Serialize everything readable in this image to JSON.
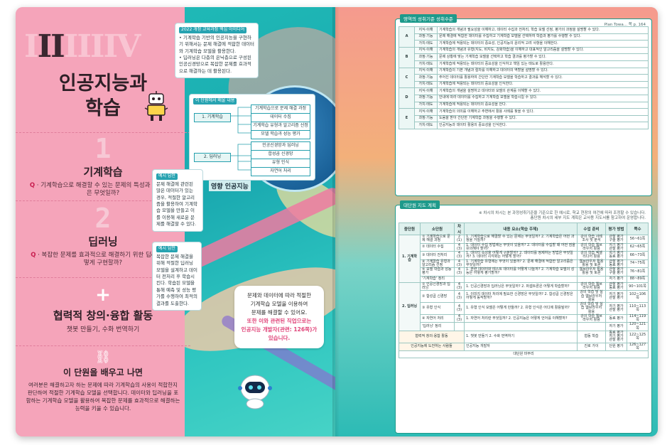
{
  "left": {
    "romans": [
      "I",
      "II",
      "III",
      "IV"
    ],
    "title_line1": "인공지능과",
    "title_line2": "학습",
    "sections": [
      {
        "num": "1",
        "title": "기계학습",
        "q_mark": "Q",
        "question": "기계학습으로 해결할 수 있는 문제의 특성과 해결 방법은 무엇일까?"
      },
      {
        "num": "2",
        "title": "딥러닝",
        "q_mark": "Q",
        "question": "복잡한 문제를 효과적으로 해결하기 위한 딥러닝은 어떻게 구현할까?"
      }
    ],
    "activity": {
      "symbol": "+",
      "title": "협력적 창의·융합 활동",
      "sub": "챗봇 만들기, 수화 번역하기"
    },
    "learn": {
      "title": "이 단원을 배우고 나면",
      "desc": "여러분은 해결하고자 하는 문제에 따라 기계학습의 사용이 적합한지 판단하여 적절한 기계학습 모델을 선택합니다. 데이터와 딥러닝을 포함하는 기계학습 모델을 활용하여 복잡한 문제를 효과적으로 해결하는 능력을 키울 수 있습니다."
    },
    "callout1": {
      "tag": "2022 개정 교육과정 핵심 아이디어",
      "text": "• 기계학습 기반의 인공지능을 구현하기 위해서는 문제 해결에 적합한 데이터와 기계학습 모델을 활용한다.\n• 딥러닝은 다층의 은닉층으로 구성된 인공신경망으로 복잡한 문제를 효과적으로 해결하는 데 활용된다."
    },
    "callout2": {
      "tag": "이 단원에서 배울 내용",
      "left1": "1. 기계학습",
      "left2": "2. 딥러닝",
      "items1": [
        "기계학습으로 문제 해결 과정",
        "데이터 수집",
        "기계학습 유형과 알고리즘 선정",
        "모델 학습과 성능 평가"
      ],
      "items2": [
        "인공신경망과 딥러닝",
        "합성곱 신경망",
        "유형 인식",
        "자연어 처리"
      ]
    },
    "callout3": {
      "tag": "예시 답안",
      "text": "문제 해결에 관련된 많은 데이터가 있는 경우, 적절한 알고리즘을 활용하여 기계학습 모델을 만들고 이를 이용해 새로운 문제를 해결할 수 있다."
    },
    "callout4": {
      "tag": "예시 답안",
      "text": "복잡한 문제 해결을 위해 적절한 딥러닝 모델을 설계하고 데이터 전처리 후 학습시킨다. 학습된 모델을 통해 예측 및 성능 평가를 수행하여 최적의 결과를 도출한다."
    },
    "scene_label": "영향 인공지능",
    "bubble": {
      "line1": "문제와 데이터에 따라 적절한",
      "line2": "기계학습 모델을 이용하여",
      "line3": "문제를 해결할 수 있어요.",
      "hi1": "또한 이와 관련된 직업으로는",
      "hi2": "인공지능 개발자(관련: 126쪽)가",
      "hi3": "있습니다."
    }
  },
  "right": {
    "panel1": {
      "head": "영역의 성취기준 성취수준",
      "caption": "Plan Towa... 쪽 p. 164",
      "rows": [
        {
          "grade": "A",
          "cat": "지식·이해",
          "text": "기계학습의 개념과 필요성을 이해하고, 데이터 수집과 전처리, 학습 모델 선정, 평가의 과정을 설명할 수 있다."
        },
        {
          "grade": "",
          "cat": "과정·기능",
          "text": "문제 해결에 적합한 데이터를 수집하고 기계학습 모델을 선택하여 학습과 평가를 수행할 수 있다."
        },
        {
          "grade": "",
          "cat": "가치·태도",
          "text": "기계학습에 적용되는 데이터의 중요성, 인공지능의 윤리적 고려 사항을 이해한다."
        },
        {
          "grade": "B",
          "cat": "지식·이해",
          "text": "기계학습의 개념과 유형(지도, 비지도, 강화학습)을 이해하고 대표적인 알고리즘을 설명할 수 있다."
        },
        {
          "grade": "",
          "cat": "과정·기능",
          "text": "문제 상황에 맞는 기계학습 모델을 선택하고 학습 결과를 평가할 수 있다."
        },
        {
          "grade": "",
          "cat": "가치·태도",
          "text": "기계학습에 적용되는 데이터의 중요성을 인식하고 책임 있는 태도로 활용한다."
        },
        {
          "grade": "C",
          "cat": "지식·이해",
          "text": "기계학습의 기본 개념과 절차를 이해하고 데이터의 역할을 설명할 수 있다."
        },
        {
          "grade": "",
          "cat": "과정·기능",
          "text": "주어진 데이터를 활용하여 간단한 기계학습 모델을 학습하고 결과를 해석할 수 있다."
        },
        {
          "grade": "",
          "cat": "가치·태도",
          "text": "기계학습에 적용되는 데이터의 중요성을 인식한다."
        },
        {
          "grade": "D",
          "cat": "지식·이해",
          "text": "기계학습의 개념을 설명하고 데이터와 모델의 관계를 이해할 수 있다."
        },
        {
          "grade": "",
          "cat": "과정·기능",
          "text": "안내에 따라 데이터를 수집하고 기계학습 모델을 학습시킬 수 있다."
        },
        {
          "grade": "",
          "cat": "가치·태도",
          "text": "기계학습에 적용되는 데이터의 중요성을 안다."
        },
        {
          "grade": "E",
          "cat": "지식·이해",
          "text": "기계학습의 의미를 이해하고 주변에서 활용 사례를 찾을 수 있다."
        },
        {
          "grade": "",
          "cat": "과정·기능",
          "text": "도움을 받아 간단한 기계학습 과정을 수행할 수 있다."
        },
        {
          "grade": "",
          "cat": "가치·태도",
          "text": "인공지능과 데이터 활용의 중요성을 인식한다."
        }
      ]
    },
    "panel2": {
      "head": "대단원 지도 계획",
      "note1": "※ 차시의 차시는 본 과정성취기준을 기준으로 한 예시로, 학교 현장의 여건에 따라 조정할 수 있습니다.",
      "note2": "총단원 차시의 세부 지도 계획은 교사용 지도서를 참고하여 운영합니다.",
      "headers": [
        "중단원",
        "소단원",
        "차시",
        "내용 요소(학습 주제)",
        "수업 준비",
        "평가 방법",
        "쪽수"
      ],
      "rows": [
        {
          "mid": "1. 기계학습",
          "sub": "① 기계학습으로 문제 해결 과정",
          "hours": "2 (1)",
          "content": "1. 기계학습으로 해결할 수 있는 문제는 무엇일까? 2. 기계학습은 어떤 과정을 거칠까?",
          "prep": "강의 학습 사례 조사 및 분석",
          "eval": "관찰 평가 구술 평가",
          "pages": "56~61쪽"
        },
        {
          "mid": "",
          "sub": "② 데이터 수집",
          "hours": "4 (3)",
          "content": "1. 데이터 수집 방법에는 무엇이 있을까? 2. 데이터를 수집할 때 어떤 점을 유의해야 할까?",
          "prep": "강의 학습 웹브라우저 활용",
          "eval": "자기 평가 관찰 평가",
          "pages": "62~65쪽"
        },
        {
          "mid": "",
          "sub": "③ 데이터 전처리",
          "hours": "4 (3)",
          "content": "1. 데이터 속성을 어떻게 구분할까? 2. 데이터를 정제하는 방법은 무엇일까? 3. 데이터 시각화는 어떻게 할까?",
          "prep": "강의 학습 엑셀리디어 활용",
          "eval": "자기 평가 동료 평가",
          "pages": "66~73쪽"
        },
        {
          "mid": "",
          "sub": "④ 기계학습 유형과 알고리즘 선정",
          "hours": "4 (3)",
          "content": "1. 기계학습 유형에는 무엇이 있을까? 2. 문제 해결에 적합한 알고리즘은 무엇일까?",
          "prep": "웹브라우저 활용 활용 및 토론",
          "eval": "관찰 평가 동료 평가",
          "pages": "74~75쪽"
        },
        {
          "mid": "",
          "sub": "⑤ 모델 학습과 성능 평가",
          "hours": "4 (3)",
          "content": "1. 훈련 데이터와 테스트 데이터를 어떻게 나눌까? 2. 기계학습 모델의 성능은 어떻게 평가할까?",
          "prep": "웹브라우저 활용 활용 및 토론",
          "eval": "관찰 평가 구술 평가",
          "pages": "76~81쪽"
        },
        {
          "mid": "",
          "sub": "'기계학습' 정리",
          "hours": "",
          "content": "",
          "prep": "",
          "eval": "자기 평가",
          "pages": "88~89쪽"
        },
        {
          "mid": "2. 딥러닝",
          "sub": "① 인공신경망과 딥러닝",
          "hours": "4 (3)",
          "content": "1. 인공신경망과 딥러닝은 무엇일까? 2. 퍼셉트론은 어떻게 학습할까?",
          "prep": "강의 학습 웹브라우저 활용",
          "eval": "관찰 평가 동료 평가",
          "pages": "90~101쪽"
        },
        {
          "mid": "",
          "sub": "② 합성곱 신경망",
          "hours": "4 (3)",
          "content": "1. 이미지 데이터 처리에 필요한 신경망은 무엇일까? 2. 합성곱 신경망은 어떻게 동작할까?",
          "prep": "강의 학습 및 실습 웹브라우저 활용",
          "eval": "자기 평가 관찰 평가",
          "pages": "102~106쪽"
        },
        {
          "mid": "",
          "sub": "③ 유형 인식",
          "hours": "4 (3)",
          "content": "1. 유형 인식 모델은 어떻게 만들까? 2. 유형 인식은 어디에 활용될까?",
          "prep": "강의 학습 및 실습 웹브라우저 활용",
          "eval": "자기 평가 관찰 평가",
          "pages": "110~113쪽"
        },
        {
          "mid": "",
          "sub": "④ 자연어 처리",
          "hours": "4 (3)",
          "content": "1. 자연어 처리란 무엇일까? 2. 인공지능은 어떻게 언어를 이해할까?",
          "prep": "강의 학습 웹브라우저 활용",
          "eval": "동료 평가",
          "pages": "114~119쪽"
        },
        {
          "mid": "",
          "sub": "'딥러닝' 정리",
          "hours": "",
          "content": "",
          "prep": "",
          "eval": "자기 평가",
          "pages": "120~121쪽"
        },
        {
          "mid": "협력적 창의·융합 활동",
          "sub": "",
          "hours": "",
          "content": "1. 챗봇 만들기 2. 수화 번역하기",
          "prep": "협동 학습",
          "eval": "동료 평가 자기 평가 관찰 평가",
          "pages": "122~125쪽"
        },
        {
          "mid": "인공지능에 도전하는 사람들",
          "sub": "",
          "hours": "",
          "content": "인공지능 개발자",
          "prep": "진로 가이",
          "eval": "단원 평가",
          "pages": "126~127쪽"
        }
      ],
      "footer": "대단원 마무리"
    }
  }
}
